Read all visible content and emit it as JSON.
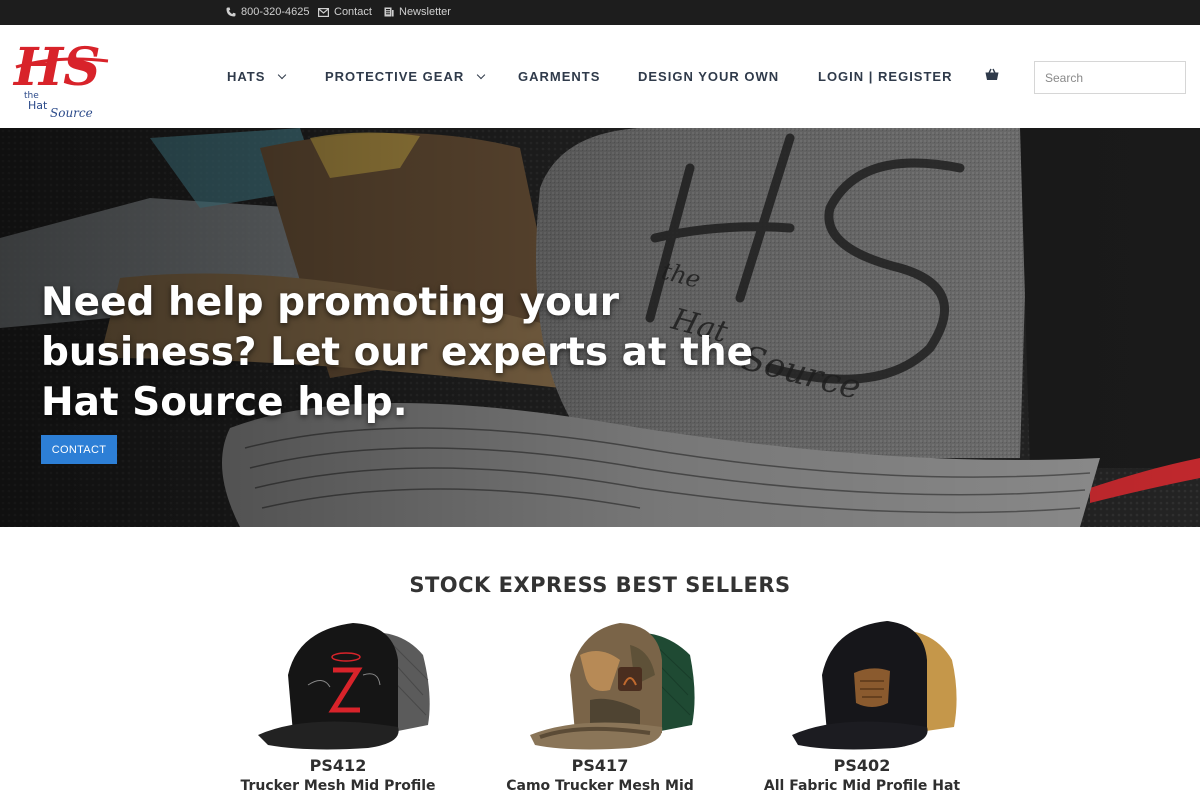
{
  "topbar": {
    "phone": "800-320-4625",
    "contact": "Contact",
    "newsletter": "Newsletter"
  },
  "logo": {
    "mark": "HS",
    "line1": "the",
    "line2": "Hat",
    "line3": "Source",
    "color": "#d8232a"
  },
  "nav": {
    "hats": "HATS",
    "protective": "PROTECTIVE GEAR",
    "garments": "GARMENTS",
    "design": "DESIGN YOUR OWN",
    "login": "LOGIN | REGISTER",
    "cart_icon": "shopping-basket-icon"
  },
  "search": {
    "placeholder": "Search"
  },
  "hero": {
    "title": "Need help promoting your business? Let our experts at the Hat Source help.",
    "button": "CONTACT",
    "button_color": "#2d7fd6"
  },
  "bestsellers": {
    "title": "STOCK EXPRESS BEST SELLERS",
    "products": [
      {
        "sku": "PS412",
        "name": "Trucker Mesh Mid Profile"
      },
      {
        "sku": "PS417",
        "name": "Camo Trucker Mesh Mid"
      },
      {
        "sku": "PS402",
        "name": "All Fabric Mid Profile Hat"
      }
    ]
  }
}
